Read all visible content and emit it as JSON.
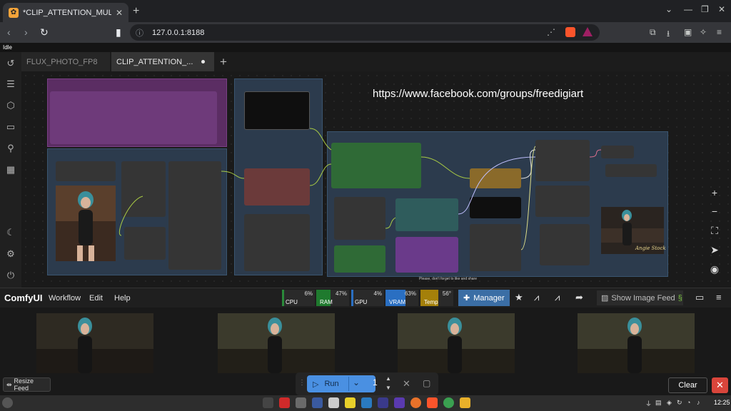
{
  "browser": {
    "tab_title": "*CLIP_ATTENTION_MULTIP",
    "new_tab_symbol": "+",
    "url": "127.0.0.1:8188"
  },
  "app": {
    "status": "Idle",
    "workflow_tabs": [
      {
        "label": "FLUX_PHOTO_FP8"
      },
      {
        "label": "CLIP_ATTENTION_..."
      }
    ],
    "canvas_overlay_text": "https://www.facebook.com/groups/freedigiart",
    "canvas_fine_print": "Please, don't forget to like and share",
    "signature_text": "Angie Stock"
  },
  "menu": {
    "brand": "ComfyUI",
    "items": [
      "Workflow",
      "Edit",
      "Help"
    ],
    "monitors": [
      {
        "label": "CPU",
        "pct": "6%",
        "color": "#2a8a3a"
      },
      {
        "label": "RAM",
        "pct": "47%",
        "color": "#1f7a2e"
      },
      {
        "label": "GPU",
        "pct": "4%",
        "color": "#2a6fc2"
      },
      {
        "label": "VRAM",
        "pct": "63%",
        "color": "#2a6fc2"
      },
      {
        "label": "Temp",
        "pct": "56°",
        "color": "#a4800a"
      }
    ],
    "manager_label": "Manager",
    "feed_label": "Show Image Feed"
  },
  "feed": {
    "resize_label": "Resize Feed",
    "clear_label": "Clear"
  },
  "queue": {
    "run_label": "Run",
    "count": "1"
  },
  "taskbar": {
    "time": "12:25"
  }
}
